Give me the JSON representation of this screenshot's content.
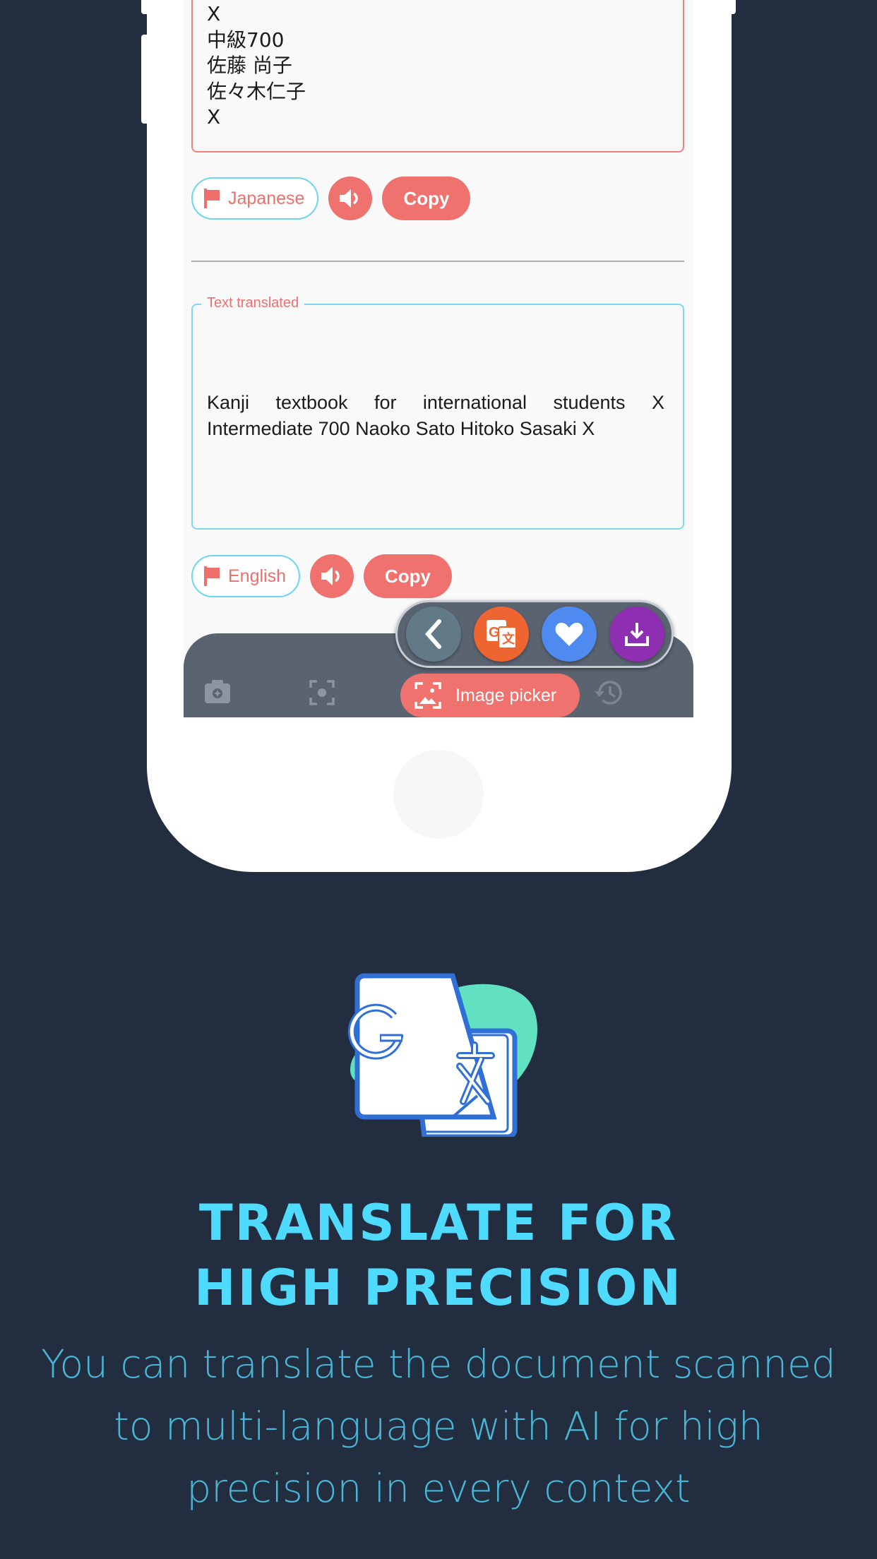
{
  "screen": {
    "source": {
      "text_lines": [
        "X",
        "中級700",
        "佐藤 尚子",
        "佐々木仁子",
        "X"
      ],
      "language_label": "Japanese",
      "copy_label": "Copy"
    },
    "target": {
      "label": "Text translated",
      "text": "Kanji textbook for international students X Intermediate 700 Naoko Sato Hitoko Sasaki X",
      "language_label": "English",
      "copy_label": "Copy"
    },
    "fab_group": {
      "items": [
        {
          "icon": "chevron-left-icon",
          "color": "#627a87"
        },
        {
          "icon": "google-translate-icon",
          "color": "#ef6532"
        },
        {
          "icon": "heart-icon",
          "color": "#4f8af1"
        },
        {
          "icon": "download-icon",
          "color": "#8d2fb0"
        }
      ]
    },
    "bottom_bar": {
      "items": [
        {
          "icon": "camera-icon"
        },
        {
          "icon": "focus-scan-icon"
        },
        {
          "icon": "image-picker-icon",
          "label": "Image picker",
          "active": true
        },
        {
          "icon": "history-icon"
        }
      ]
    }
  },
  "marketing": {
    "headline_line1": "TRANSLATE FOR",
    "headline_line2": "HIGH PRECISION",
    "description": "You can translate the document scanned to multi-language with AI for high precision in every context"
  },
  "colors": {
    "background": "#222e3f",
    "accent_coral": "#ef726f",
    "accent_cyan": "#4fdbff",
    "description_text": "#48b6d7",
    "bottom_bar": "#5a6370"
  }
}
